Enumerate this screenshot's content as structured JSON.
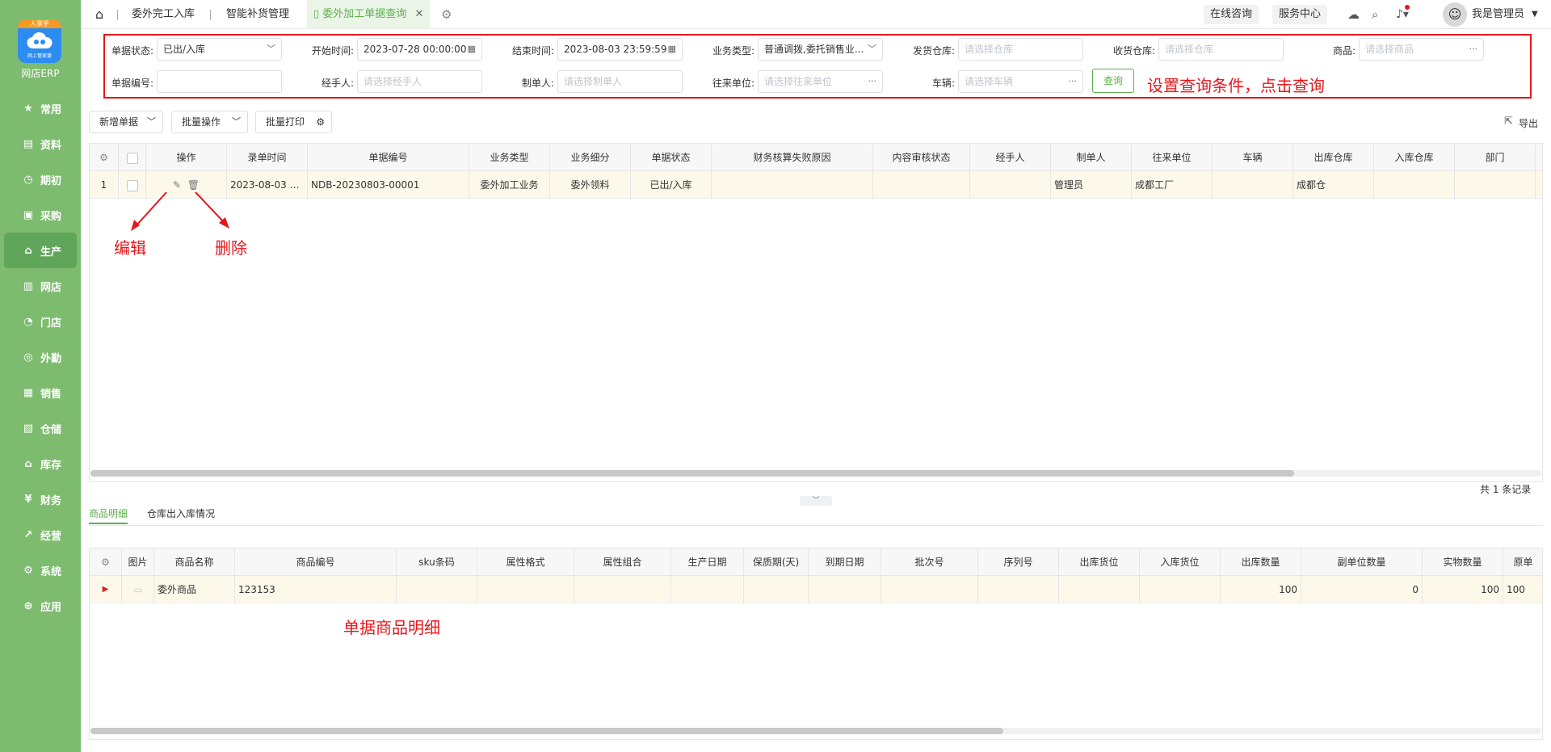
{
  "brand": {
    "badge": "人掌手",
    "sub": "网上管家婆",
    "app_name": "网店ERP",
    "accent": "#7dbb6f",
    "active_color": "#5fae4f"
  },
  "sidebar": {
    "items": [
      {
        "label": "常用",
        "icon": "star-icon"
      },
      {
        "label": "资料",
        "icon": "document-icon"
      },
      {
        "label": "期初",
        "icon": "clock-icon"
      },
      {
        "label": "采购",
        "icon": "monitor-icon"
      },
      {
        "label": "生产",
        "icon": "factory-icon"
      },
      {
        "label": "网店",
        "icon": "store-icon"
      },
      {
        "label": "门店",
        "icon": "pie-icon"
      },
      {
        "label": "外勤",
        "icon": "target-icon"
      },
      {
        "label": "销售",
        "icon": "chart-icon"
      },
      {
        "label": "仓储",
        "icon": "warehouse-icon"
      },
      {
        "label": "库存",
        "icon": "home-icon"
      },
      {
        "label": "财务",
        "icon": "money-icon"
      },
      {
        "label": "经营",
        "icon": "trend-icon"
      },
      {
        "label": "系统",
        "icon": "gear-icon"
      },
      {
        "label": "应用",
        "icon": "plus-icon"
      }
    ]
  },
  "tabs": {
    "items": [
      "委外完工入库",
      "智能补货管理",
      "委外加工单据查询"
    ]
  },
  "topbar": {
    "consult": "在线咨询",
    "service": "服务中心",
    "user": "我是管理员"
  },
  "filter": {
    "status_label": "单据状态:",
    "status_value": "已出/入库",
    "start_label": "开始时间:",
    "start_value": "2023-07-28 00:00:00",
    "end_label": "结束时间:",
    "end_value": "2023-08-03 23:59:59",
    "biz_type_label": "业务类型:",
    "biz_type_value": "普通调拨,委托销售业...",
    "send_wh_label": "发货仓库:",
    "send_wh_placeholder": "请选择仓库",
    "recv_wh_label": "收货仓库:",
    "recv_wh_placeholder": "请选择仓库",
    "goods_label": "商品:",
    "goods_placeholder": "请选择商品",
    "doc_no_label": "单据编号:",
    "handler_label": "经手人:",
    "handler_placeholder": "请选择经手人",
    "maker_label": "制单人:",
    "maker_placeholder": "请选择制单人",
    "partner_label": "往来单位:",
    "partner_placeholder": "请选择往来单位",
    "vehicle_label": "车辆:",
    "vehicle_placeholder": "请选择车辆",
    "query_button": "查询"
  },
  "annotations": {
    "query": "设置查询条件，点击查询",
    "edit": "编辑",
    "delete": "删除",
    "detail": "单据商品明细"
  },
  "toolbar": {
    "new_doc": "新增单据",
    "batch_op": "批量操作",
    "batch_print": "批量打印",
    "export": "导出"
  },
  "main_table": {
    "headers": [
      "操作",
      "录单时间",
      "单据编号",
      "业务类型",
      "业务细分",
      "单据状态",
      "财务核算失败原因",
      "内容审核状态",
      "经手人",
      "制单人",
      "往来单位",
      "车辆",
      "出库仓库",
      "入库仓库",
      "部门"
    ],
    "rows": [
      {
        "index": "1",
        "time": "2023-08-03 1...",
        "doc_no": "NDB-20230803-00001",
        "biz_type": "委外加工业务",
        "biz_sub": "委外领料",
        "status": "已出/入库",
        "fail_reason": "",
        "audit": "",
        "handler": "",
        "maker": "管理员",
        "partner": "成都工厂",
        "vehicle": "",
        "out_wh": "成都仓",
        "in_wh": "",
        "dept": ""
      }
    ],
    "total": "共 1 条记录"
  },
  "detail_tabs": {
    "items": [
      "商品明细",
      "仓库出入库情况"
    ]
  },
  "detail_table": {
    "headers": [
      "图片",
      "商品名称",
      "商品编号",
      "sku条码",
      "属性格式",
      "属性组合",
      "生产日期",
      "保质期(天)",
      "到期日期",
      "批次号",
      "序列号",
      "出库货位",
      "入库货位",
      "出库数量",
      "副单位数量",
      "实物数量",
      "原单"
    ],
    "rows": [
      {
        "name": "委外商品",
        "code": "123153",
        "sku": "",
        "attr_fmt": "",
        "attr_combo": "",
        "prod_date": "",
        "shelf": "",
        "expire": "",
        "batch": "",
        "serial": "",
        "out_loc": "",
        "in_loc": "",
        "out_qty": "100",
        "sub_qty": "0",
        "real_qty": "100",
        "orig": "100"
      }
    ]
  }
}
